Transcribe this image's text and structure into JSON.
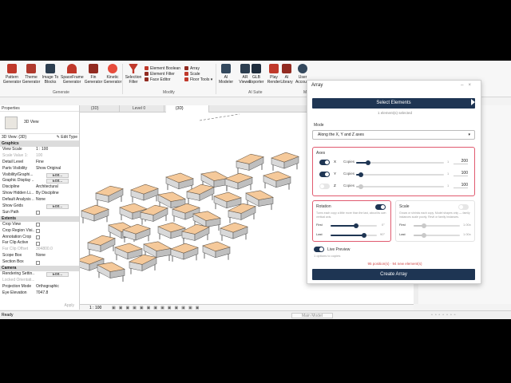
{
  "ribbon": {
    "buttons": [
      {
        "label": "Pattern\nGenerator",
        "icon": "pattern-icon"
      },
      {
        "label": "Theme\nGenerator",
        "icon": "theme-icon"
      },
      {
        "label": "Image To\nBlocks",
        "icon": "image-icon"
      },
      {
        "label": "SpaceFrame\nGenerator",
        "icon": "spaceframe-icon"
      },
      {
        "label": "Fin\nGenerator",
        "icon": "fin-icon"
      },
      {
        "label": "Kinetic\nGenerator",
        "icon": "kinetic-icon"
      },
      {
        "label": "Selection\nFilter",
        "icon": "filter-icon"
      }
    ],
    "modify_items": [
      "Element Boolean",
      "Element Filter",
      "Face Editor"
    ],
    "modify_items2": [
      "Array",
      "Scale",
      "Floor Tools"
    ],
    "ai_buttons": [
      {
        "label": "AI\nModeler",
        "icon": "ai-modeler-icon"
      },
      {
        "label": "AR\nViewer",
        "icon": "ar-icon"
      },
      {
        "label": "GLB\nExporter",
        "icon": "glb-icon"
      },
      {
        "label": "Play\nRender",
        "icon": "play-icon"
      },
      {
        "label": "AI\nLibrary",
        "icon": "library-icon"
      },
      {
        "label": "User\nAccount",
        "icon": "user-icon"
      }
    ],
    "groups": [
      "Generate",
      "Modify",
      "AI Suite",
      "M"
    ]
  },
  "properties": {
    "title": "Properties",
    "type_name": "3D View",
    "selector": "3D View: {3D}",
    "edit_type": "Edit Type",
    "sections": [
      {
        "name": "Graphics",
        "rows": [
          {
            "k": "View Scale",
            "v": "1 : 100",
            "kind": "text"
          },
          {
            "k": "Scale Value 1:",
            "v": "100",
            "kind": "text",
            "dim": true
          },
          {
            "k": "Detail Level",
            "v": "Fine",
            "kind": "text"
          },
          {
            "k": "Parts Visibility",
            "v": "Show Original",
            "kind": "text"
          },
          {
            "k": "Visibility/Graphi...",
            "v": "Edit...",
            "kind": "btn"
          },
          {
            "k": "Graphic Display ...",
            "v": "Edit...",
            "kind": "btn"
          },
          {
            "k": "Discipline",
            "v": "Architectural",
            "kind": "text"
          },
          {
            "k": "Show Hidden Li...",
            "v": "By Discipline",
            "kind": "text"
          },
          {
            "k": "Default Analysis ...",
            "v": "None",
            "kind": "text"
          },
          {
            "k": "Show Grids",
            "v": "Edit...",
            "kind": "btn"
          },
          {
            "k": "Sun Path",
            "v": "",
            "kind": "box"
          }
        ]
      },
      {
        "name": "Extents",
        "rows": [
          {
            "k": "Crop View",
            "v": "",
            "kind": "box"
          },
          {
            "k": "Crop Region Visi...",
            "v": "",
            "kind": "box"
          },
          {
            "k": "Annotation Crop",
            "v": "",
            "kind": "box"
          },
          {
            "k": "Far Clip Active",
            "v": "",
            "kind": "box"
          },
          {
            "k": "Far Clip Offset",
            "v": "304800.0",
            "kind": "text",
            "dim": true
          },
          {
            "k": "Scope Box",
            "v": "None",
            "kind": "text"
          },
          {
            "k": "Section Box",
            "v": "",
            "kind": "box"
          }
        ]
      },
      {
        "name": "Camera",
        "rows": [
          {
            "k": "Rendering Settin...",
            "v": "Edit...",
            "kind": "btn"
          },
          {
            "k": "Locked Orientati...",
            "v": "",
            "kind": "text",
            "dim": true
          },
          {
            "k": "Projection Mode",
            "v": "Orthographic",
            "kind": "text"
          },
          {
            "k": "Eye Elevation",
            "v": "7047.8",
            "kind": "text"
          }
        ]
      }
    ],
    "apply": "Apply"
  },
  "tabs": [
    "{3D}",
    "Level 0",
    "{3D}"
  ],
  "view_scale": "1 : 100",
  "status": {
    "left": "Ready",
    "model": "Main Model"
  },
  "dialog": {
    "title": "Array",
    "select_button": "Select Elements",
    "selected_info": "1 element(s) selected",
    "mode_label": "Mode",
    "mode_value": "Along the X, Y and Z axes",
    "axes_label": "Axes",
    "axes": [
      {
        "axis": "X",
        "copies_label": "Copies",
        "min": "1",
        "value": "200",
        "fraction": 0.14,
        "on": true
      },
      {
        "axis": "Y",
        "copies_label": "Copies",
        "min": "1",
        "value": "100",
        "fraction": 0.05,
        "on": true
      },
      {
        "axis": "Z",
        "copies_label": "Copies",
        "min": "1",
        "value": "100",
        "fraction": 0.05,
        "on": false
      }
    ],
    "rotation": {
      "label": "Rotation",
      "desc": "Turns each copy a little more than the last, about its own vertical axis.",
      "first_label": "First",
      "first_value": "0°",
      "first_fraction": 0.55,
      "last_label": "Last",
      "last_value": "90°",
      "last_fraction": 0.72
    },
    "scale": {
      "label": "Scale",
      "desc": "Grows or shrinks each copy. Model shapes only — family instances scale poorly. Revit or family instances.",
      "first_label": "First",
      "first_value": "1.00x",
      "first_fraction": 0.22,
      "last_label": "Last",
      "last_value": "1.00x",
      "last_fraction": 0.22
    },
    "live_preview_label": "Live Preview",
    "live_preview_sub": "1 options to copies",
    "warning": "95 position(s) · 94 new element(s)",
    "create_button": "Create Array"
  },
  "colors": {
    "accent": "#1e3553",
    "highlight": "#e05a6f",
    "desk": "#f5c99a"
  }
}
